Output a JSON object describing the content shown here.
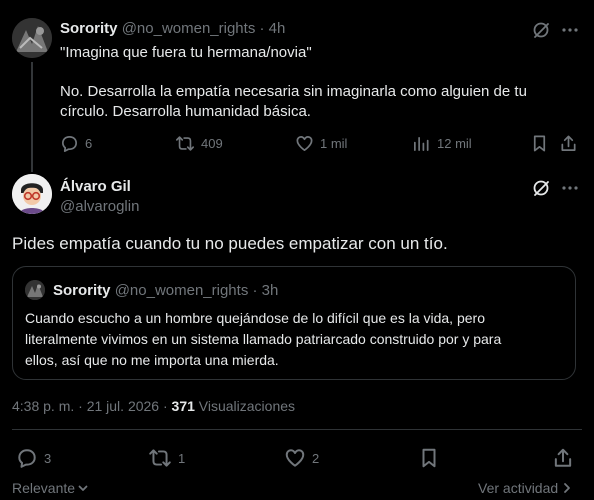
{
  "parent_post": {
    "author_name": "Sorority",
    "handle": "@no_women_rights",
    "dot": "·",
    "time": "4h",
    "line1": "\"Imagina que fuera tu hermana/novia\"",
    "line2": "No. Desarrolla la empatía necesaria sin imaginarla como alguien de tu",
    "line3": "círculo. Desarrolla humanidad básica.",
    "replies": "6",
    "reposts": "409",
    "likes": "1 mil",
    "views": "12 mil"
  },
  "main_post": {
    "author_name": "Álvaro Gil",
    "handle": "@alvaroglin",
    "text": "Pides empatía cuando tu no puedes empatizar con un tío.",
    "timestamp": "4:38 p. m. · 21 jul. 2026 ·",
    "view_count": "371",
    "views_label": "Visualizaciones",
    "replies": "3",
    "reposts": "1",
    "likes": "2"
  },
  "quoted_post": {
    "author_name": "Sorority",
    "handle": "@no_women_rights",
    "dot": "·",
    "time": "3h",
    "line1": "Cuando escucho a un hombre quejándose de lo difícil que es la vida, pero",
    "line2": "literalmente vivimos en un sistema llamado patriarcado construido por y para",
    "line3": "ellos, así que no me importa una mierda."
  },
  "footer": {
    "sort_label": "Relevante",
    "activity_label": "Ver actividad"
  },
  "colors": {
    "background": "#000000",
    "text": "#e7e9ea",
    "muted": "#71767b",
    "border": "#2f3336"
  }
}
